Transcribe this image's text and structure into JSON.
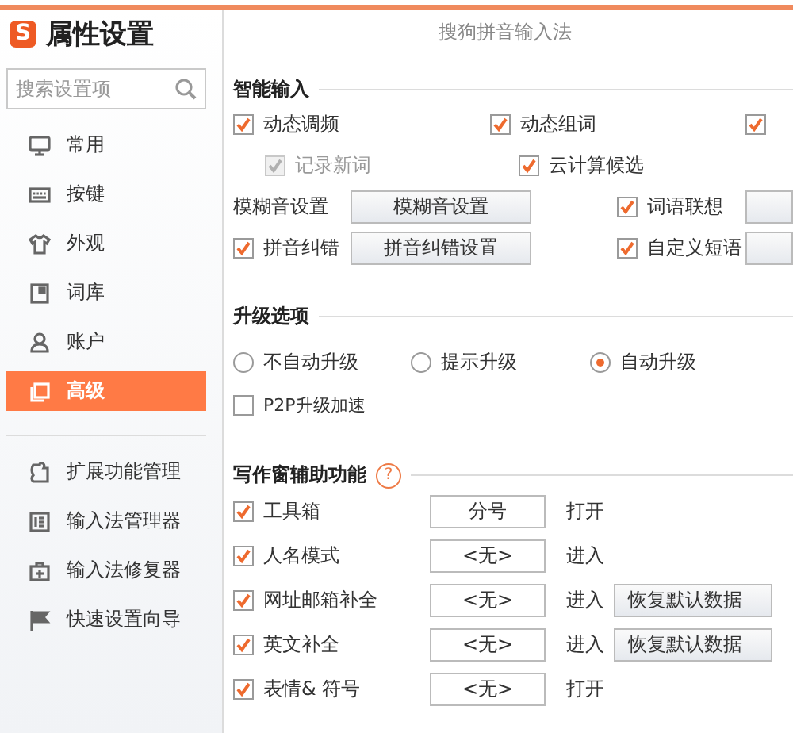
{
  "window": {
    "logo": "S",
    "title": "属性设置",
    "subtitle": "搜狗拼音输入法"
  },
  "sidebar": {
    "search": {
      "placeholder": "搜索设置项"
    },
    "items": [
      {
        "label": "常用",
        "selected": false
      },
      {
        "label": "按键",
        "selected": false
      },
      {
        "label": "外观",
        "selected": false
      },
      {
        "label": "词库",
        "selected": false
      },
      {
        "label": "账户",
        "selected": false
      },
      {
        "label": "高级",
        "selected": true
      }
    ],
    "tools": [
      "扩展功能管理",
      "输入法管理器",
      "输入法修复器",
      "快速设置向导"
    ]
  },
  "smart_input": {
    "title": "智能输入",
    "rows": [
      [
        {
          "kind": "checkbox",
          "label": "动态调频",
          "checked": true,
          "disabled": false
        },
        {
          "kind": "checkbox",
          "label": "动态组词",
          "checked": true,
          "disabled": false
        },
        {
          "kind": "checkbox",
          "checked": true,
          "disabled": false
        }
      ],
      [
        {
          "kind": "checkbox",
          "label": "记录新词",
          "checked": true,
          "disabled": true
        },
        {
          "kind": "checkbox",
          "label": "云计算候选",
          "checked": true,
          "disabled": false
        }
      ],
      [
        {
          "kind": "text",
          "label": "模糊音设置"
        },
        {
          "kind": "button",
          "label": "模糊音设置"
        },
        {
          "kind": "checkbox",
          "label": "词语联想",
          "checked": true,
          "disabled": false
        },
        {
          "kind": "button"
        }
      ],
      [
        {
          "kind": "checkbox",
          "label": "拼音纠错",
          "checked": true,
          "disabled": false
        },
        {
          "kind": "button",
          "label": "拼音纠错设置"
        },
        {
          "kind": "checkbox",
          "label": "自定义短语",
          "checked": true,
          "disabled": false
        },
        {
          "kind": "button"
        }
      ]
    ]
  },
  "upgrade": {
    "title": "升级选项",
    "options": [
      {
        "label": "不自动升级",
        "selected": false
      },
      {
        "label": "提示升级",
        "selected": false
      },
      {
        "label": "自动升级",
        "selected": true
      }
    ],
    "p2p": {
      "label": "P2P升级加速",
      "checked": false
    }
  },
  "writing": {
    "title": "写作窗辅助功能",
    "help": "?",
    "rows": [
      {
        "label": "工具箱",
        "checked": true,
        "key": "分号",
        "action": "打开"
      },
      {
        "label": "人名模式",
        "checked": true,
        "key": "<无>",
        "action": "进入"
      },
      {
        "label": "网址邮箱补全",
        "checked": true,
        "key": "<无>",
        "action": "进入",
        "restore": "恢复默认数据"
      },
      {
        "label": "英文补全",
        "checked": true,
        "key": "<无>",
        "action": "进入",
        "restore": "恢复默认数据"
      },
      {
        "label": "表情& 符号",
        "checked": true,
        "key": "<无>",
        "action": "打开"
      }
    ]
  }
}
